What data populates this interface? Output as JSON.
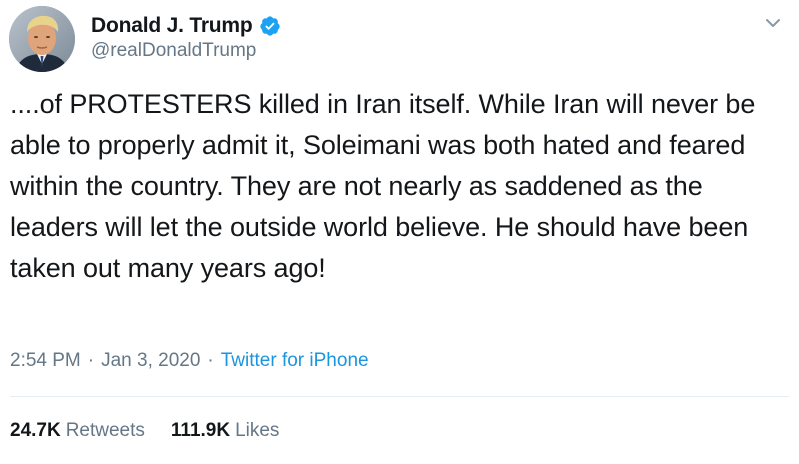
{
  "author": {
    "display_name": "Donald J. Trump",
    "handle": "@realDonaldTrump",
    "verified": true,
    "avatar_icon": "profile-photo"
  },
  "tweet": {
    "text": "....of PROTESTERS killed in Iran itself. While Iran will never be able to properly admit it, Soleimani was both hated and feared within the country. They are not nearly as saddened as the leaders will let the outside world believe. He should have been taken out many years ago!"
  },
  "meta": {
    "time": "2:54 PM",
    "separator": "·",
    "date": "Jan 3, 2020",
    "source": "Twitter for iPhone"
  },
  "stats": {
    "retweets_count": "24.7K",
    "retweets_label": "Retweets",
    "likes_count": "111.9K",
    "likes_label": "Likes"
  },
  "colors": {
    "text_primary": "#14171a",
    "text_secondary": "#657786",
    "link": "#1b95e0",
    "verified_badge": "#1da1f2",
    "divider": "#e6ecf0"
  },
  "icons": {
    "verified": "verified-badge-icon",
    "menu": "chevron-down-icon"
  }
}
